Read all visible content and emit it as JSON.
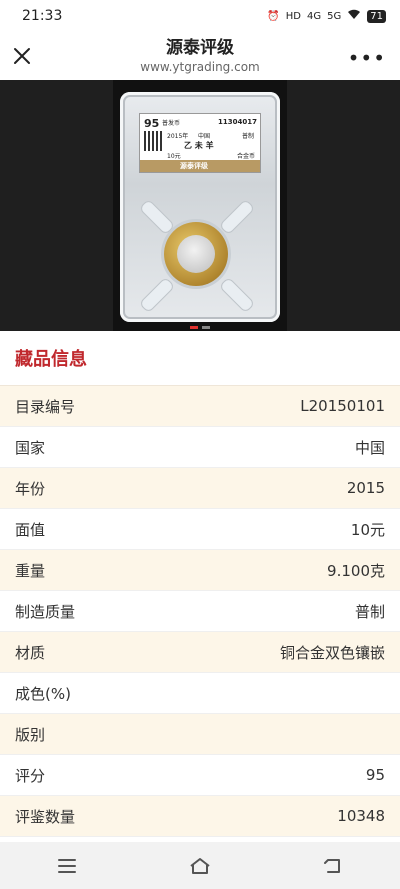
{
  "status_bar": {
    "time": "21:33",
    "network_hd": "HD",
    "signal_4g": "4G",
    "signal_5g": "5G",
    "battery": "71"
  },
  "nav": {
    "title": "源泰评级",
    "url": "www.ytgrading.com"
  },
  "slab_label": {
    "grade": "95",
    "kind": "普发币",
    "cert_number": "11304017",
    "year": "2015年",
    "country": "中国",
    "strike": "普制",
    "name": "乙 未 羊",
    "face_value": "10元",
    "material": "合金币",
    "brand": "源泰评级"
  },
  "section": {
    "title": "藏品信息"
  },
  "details": [
    {
      "label": "目录编号",
      "value": "L20150101"
    },
    {
      "label": "国家",
      "value": "中国"
    },
    {
      "label": "年份",
      "value": "2015"
    },
    {
      "label": "面值",
      "value": "10元"
    },
    {
      "label": "重量",
      "value": "9.100克"
    },
    {
      "label": "制造质量",
      "value": "普制"
    },
    {
      "label": "材质",
      "value": "铜合金双色镶嵌"
    },
    {
      "label": "成色(%)",
      "value": ""
    },
    {
      "label": "版别",
      "value": ""
    },
    {
      "label": "评分",
      "value": "95"
    },
    {
      "label": "评鉴数量",
      "value": "10348"
    }
  ],
  "icons": {
    "close": "close-icon",
    "more": "more-icon",
    "menu": "menu-icon",
    "home": "home-icon",
    "back": "back-icon"
  }
}
